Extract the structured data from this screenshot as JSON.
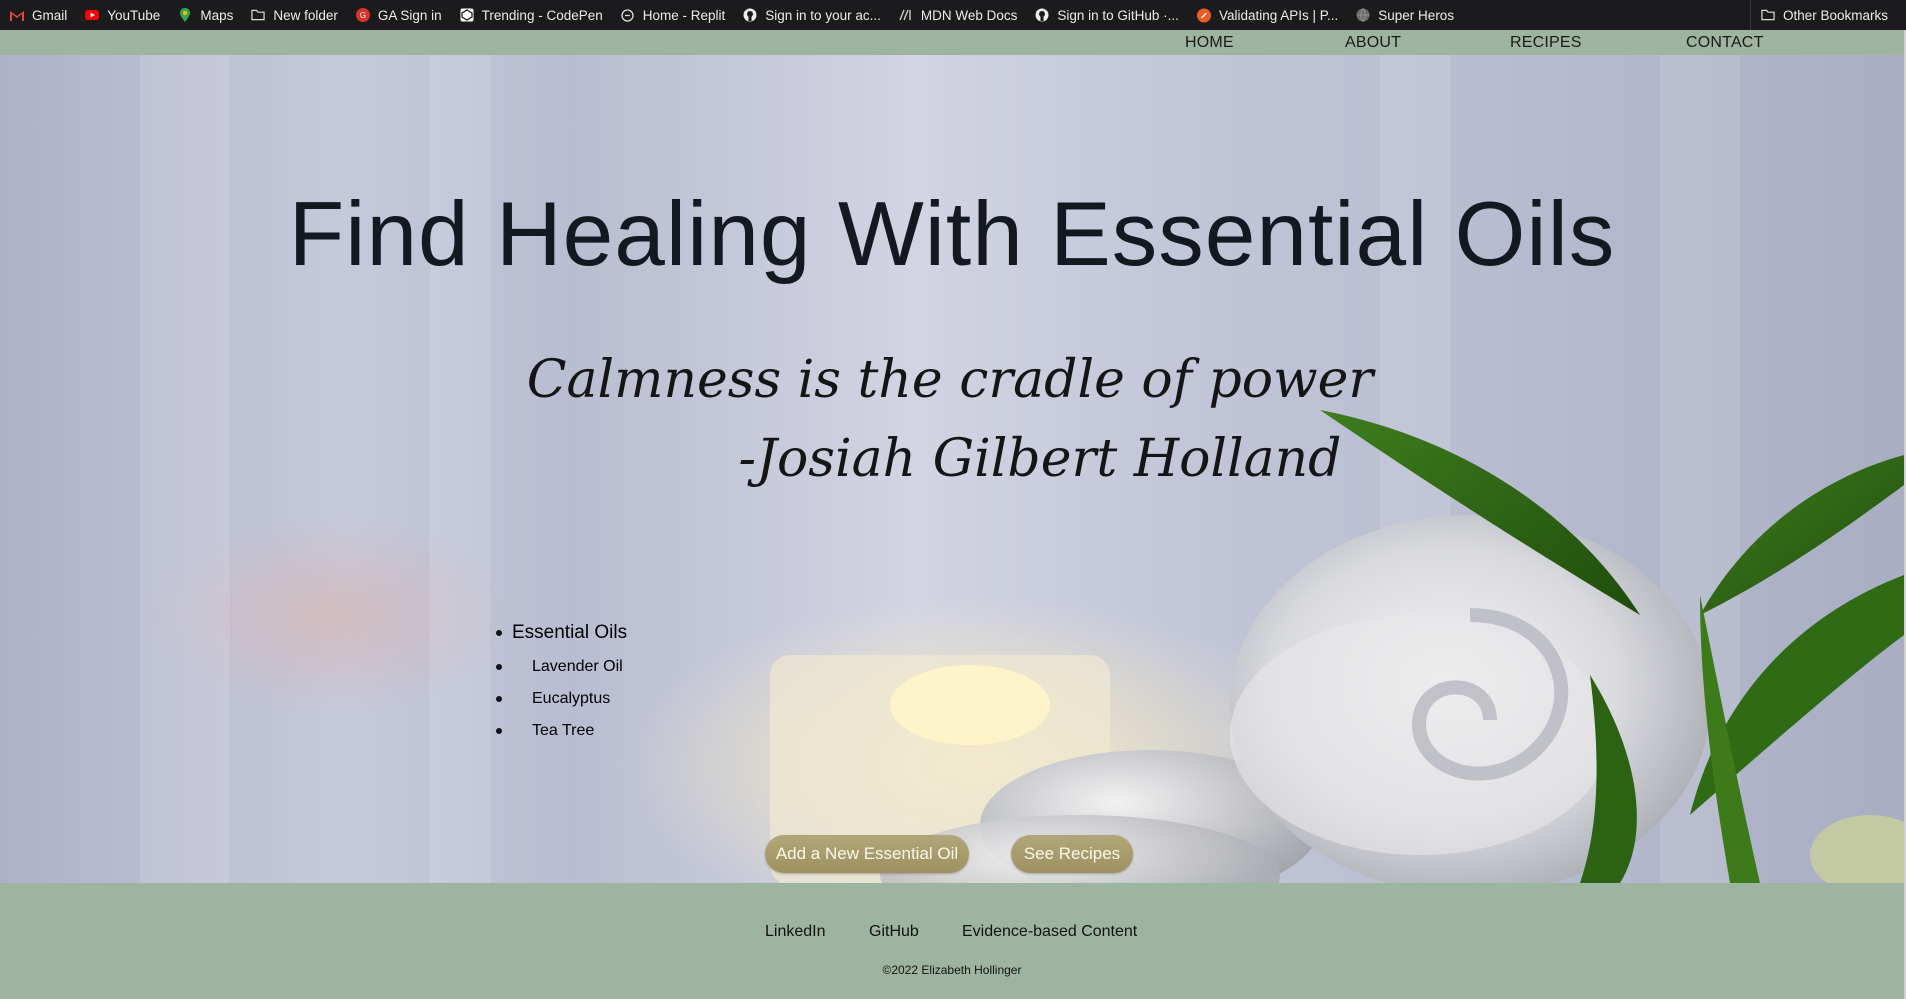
{
  "bookmarks": {
    "items": [
      {
        "label": "Gmail",
        "icon": "gmail-icon"
      },
      {
        "label": "YouTube",
        "icon": "youtube-icon"
      },
      {
        "label": "Maps",
        "icon": "maps-icon"
      },
      {
        "label": "New folder",
        "icon": "folder-icon"
      },
      {
        "label": "GA Sign in",
        "icon": "ga-icon"
      },
      {
        "label": "Trending - CodePen",
        "icon": "codepen-icon"
      },
      {
        "label": "Home - Replit",
        "icon": "replit-icon"
      },
      {
        "label": "Sign in to your ac...",
        "icon": "github-icon"
      },
      {
        "label": "MDN Web Docs",
        "icon": "mdn-icon"
      },
      {
        "label": "Sign in to GitHub ·...",
        "icon": "github-icon"
      },
      {
        "label": "Validating APIs | P...",
        "icon": "postman-icon"
      },
      {
        "label": "Super Heros",
        "icon": "globe-icon"
      }
    ],
    "other": "Other Bookmarks"
  },
  "nav": {
    "home": "HOME",
    "about": "ABOUT",
    "recipes": "RECIPES",
    "contact": "CONTACT"
  },
  "hero": {
    "title": "Find Healing With Essential Oils",
    "quote_line1": "Calmness is the cradle of power",
    "quote_line2": "-Josiah Gilbert Holland"
  },
  "oils": {
    "heading": "Essential Oils",
    "items": [
      "Lavender Oil",
      "Eucalyptus",
      "Tea Tree"
    ]
  },
  "buttons": {
    "add": "Add a New Essential Oil",
    "recipes": "See Recipes"
  },
  "footer": {
    "links": [
      "LinkedIn",
      "GitHub",
      "Evidence-based Content"
    ],
    "copyright": "©2022 Elizabeth Hollinger"
  },
  "colors": {
    "nav_bg": "#9db5a0",
    "button_bg": "#a99c69",
    "bookmarks_bg": "#1b1b1d"
  }
}
